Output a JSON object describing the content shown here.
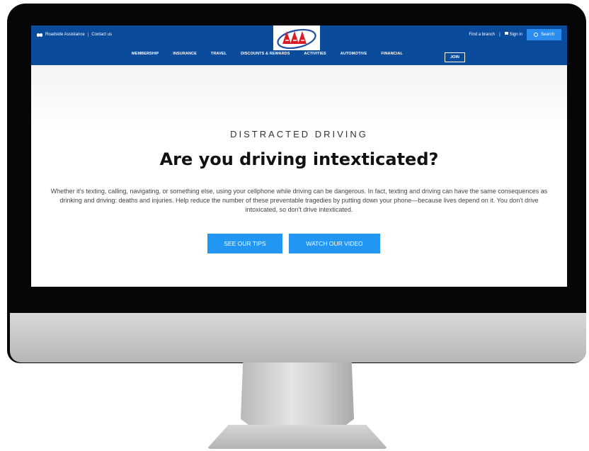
{
  "utility_left": {
    "roadside": "Roadside Assistance",
    "separator": "|",
    "contact": "Contact us"
  },
  "logo": {
    "text": "AAA"
  },
  "utility_right": {
    "find_branch": "Find a branch",
    "separator": "|",
    "sign_in": "Sign in",
    "search": "Search"
  },
  "nav": {
    "items": [
      "MEMBERSHIP",
      "INSURANCE",
      "TRAVEL",
      "DISCOUNTS & REWARDS",
      "ACTIVITIES",
      "AUTOMOTIVE",
      "FINANCIAL"
    ],
    "join": "JOIN"
  },
  "hero": {
    "eyebrow": "DISTRACTED DRIVING",
    "headline": "Are you driving intexticated?",
    "body": "Whether it's texting, calling, navigating, or something else, using your cellphone while driving can be dangerous. In fact, texting and driving can have the same consequences as drinking and driving: deaths and injuries. Help reduce the number of these preventable tragedies by putting down your phone—because lives depend on it. You don't drive intoxicated, so don't drive intexticated.",
    "btn_tips": "SEE OUR TIPS",
    "btn_video": "WATCH OUR VIDEO"
  },
  "colors": {
    "header": "#0a4b9c",
    "button": "#2196f3",
    "logo_red": "#d81e24",
    "logo_blue": "#1f4fa3"
  }
}
